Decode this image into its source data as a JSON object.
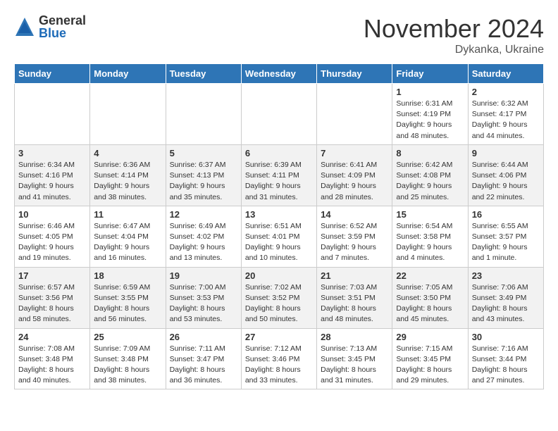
{
  "logo": {
    "general": "General",
    "blue": "Blue"
  },
  "header": {
    "title": "November 2024",
    "location": "Dykanka, Ukraine"
  },
  "weekdays": [
    "Sunday",
    "Monday",
    "Tuesday",
    "Wednesday",
    "Thursday",
    "Friday",
    "Saturday"
  ],
  "weeks": [
    [
      {
        "day": "",
        "info": ""
      },
      {
        "day": "",
        "info": ""
      },
      {
        "day": "",
        "info": ""
      },
      {
        "day": "",
        "info": ""
      },
      {
        "day": "",
        "info": ""
      },
      {
        "day": "1",
        "info": "Sunrise: 6:31 AM\nSunset: 4:19 PM\nDaylight: 9 hours\nand 48 minutes."
      },
      {
        "day": "2",
        "info": "Sunrise: 6:32 AM\nSunset: 4:17 PM\nDaylight: 9 hours\nand 44 minutes."
      }
    ],
    [
      {
        "day": "3",
        "info": "Sunrise: 6:34 AM\nSunset: 4:16 PM\nDaylight: 9 hours\nand 41 minutes."
      },
      {
        "day": "4",
        "info": "Sunrise: 6:36 AM\nSunset: 4:14 PM\nDaylight: 9 hours\nand 38 minutes."
      },
      {
        "day": "5",
        "info": "Sunrise: 6:37 AM\nSunset: 4:13 PM\nDaylight: 9 hours\nand 35 minutes."
      },
      {
        "day": "6",
        "info": "Sunrise: 6:39 AM\nSunset: 4:11 PM\nDaylight: 9 hours\nand 31 minutes."
      },
      {
        "day": "7",
        "info": "Sunrise: 6:41 AM\nSunset: 4:09 PM\nDaylight: 9 hours\nand 28 minutes."
      },
      {
        "day": "8",
        "info": "Sunrise: 6:42 AM\nSunset: 4:08 PM\nDaylight: 9 hours\nand 25 minutes."
      },
      {
        "day": "9",
        "info": "Sunrise: 6:44 AM\nSunset: 4:06 PM\nDaylight: 9 hours\nand 22 minutes."
      }
    ],
    [
      {
        "day": "10",
        "info": "Sunrise: 6:46 AM\nSunset: 4:05 PM\nDaylight: 9 hours\nand 19 minutes."
      },
      {
        "day": "11",
        "info": "Sunrise: 6:47 AM\nSunset: 4:04 PM\nDaylight: 9 hours\nand 16 minutes."
      },
      {
        "day": "12",
        "info": "Sunrise: 6:49 AM\nSunset: 4:02 PM\nDaylight: 9 hours\nand 13 minutes."
      },
      {
        "day": "13",
        "info": "Sunrise: 6:51 AM\nSunset: 4:01 PM\nDaylight: 9 hours\nand 10 minutes."
      },
      {
        "day": "14",
        "info": "Sunrise: 6:52 AM\nSunset: 3:59 PM\nDaylight: 9 hours\nand 7 minutes."
      },
      {
        "day": "15",
        "info": "Sunrise: 6:54 AM\nSunset: 3:58 PM\nDaylight: 9 hours\nand 4 minutes."
      },
      {
        "day": "16",
        "info": "Sunrise: 6:55 AM\nSunset: 3:57 PM\nDaylight: 9 hours\nand 1 minute."
      }
    ],
    [
      {
        "day": "17",
        "info": "Sunrise: 6:57 AM\nSunset: 3:56 PM\nDaylight: 8 hours\nand 58 minutes."
      },
      {
        "day": "18",
        "info": "Sunrise: 6:59 AM\nSunset: 3:55 PM\nDaylight: 8 hours\nand 56 minutes."
      },
      {
        "day": "19",
        "info": "Sunrise: 7:00 AM\nSunset: 3:53 PM\nDaylight: 8 hours\nand 53 minutes."
      },
      {
        "day": "20",
        "info": "Sunrise: 7:02 AM\nSunset: 3:52 PM\nDaylight: 8 hours\nand 50 minutes."
      },
      {
        "day": "21",
        "info": "Sunrise: 7:03 AM\nSunset: 3:51 PM\nDaylight: 8 hours\nand 48 minutes."
      },
      {
        "day": "22",
        "info": "Sunrise: 7:05 AM\nSunset: 3:50 PM\nDaylight: 8 hours\nand 45 minutes."
      },
      {
        "day": "23",
        "info": "Sunrise: 7:06 AM\nSunset: 3:49 PM\nDaylight: 8 hours\nand 43 minutes."
      }
    ],
    [
      {
        "day": "24",
        "info": "Sunrise: 7:08 AM\nSunset: 3:48 PM\nDaylight: 8 hours\nand 40 minutes."
      },
      {
        "day": "25",
        "info": "Sunrise: 7:09 AM\nSunset: 3:48 PM\nDaylight: 8 hours\nand 38 minutes."
      },
      {
        "day": "26",
        "info": "Sunrise: 7:11 AM\nSunset: 3:47 PM\nDaylight: 8 hours\nand 36 minutes."
      },
      {
        "day": "27",
        "info": "Sunrise: 7:12 AM\nSunset: 3:46 PM\nDaylight: 8 hours\nand 33 minutes."
      },
      {
        "day": "28",
        "info": "Sunrise: 7:13 AM\nSunset: 3:45 PM\nDaylight: 8 hours\nand 31 minutes."
      },
      {
        "day": "29",
        "info": "Sunrise: 7:15 AM\nSunset: 3:45 PM\nDaylight: 8 hours\nand 29 minutes."
      },
      {
        "day": "30",
        "info": "Sunrise: 7:16 AM\nSunset: 3:44 PM\nDaylight: 8 hours\nand 27 minutes."
      }
    ]
  ]
}
